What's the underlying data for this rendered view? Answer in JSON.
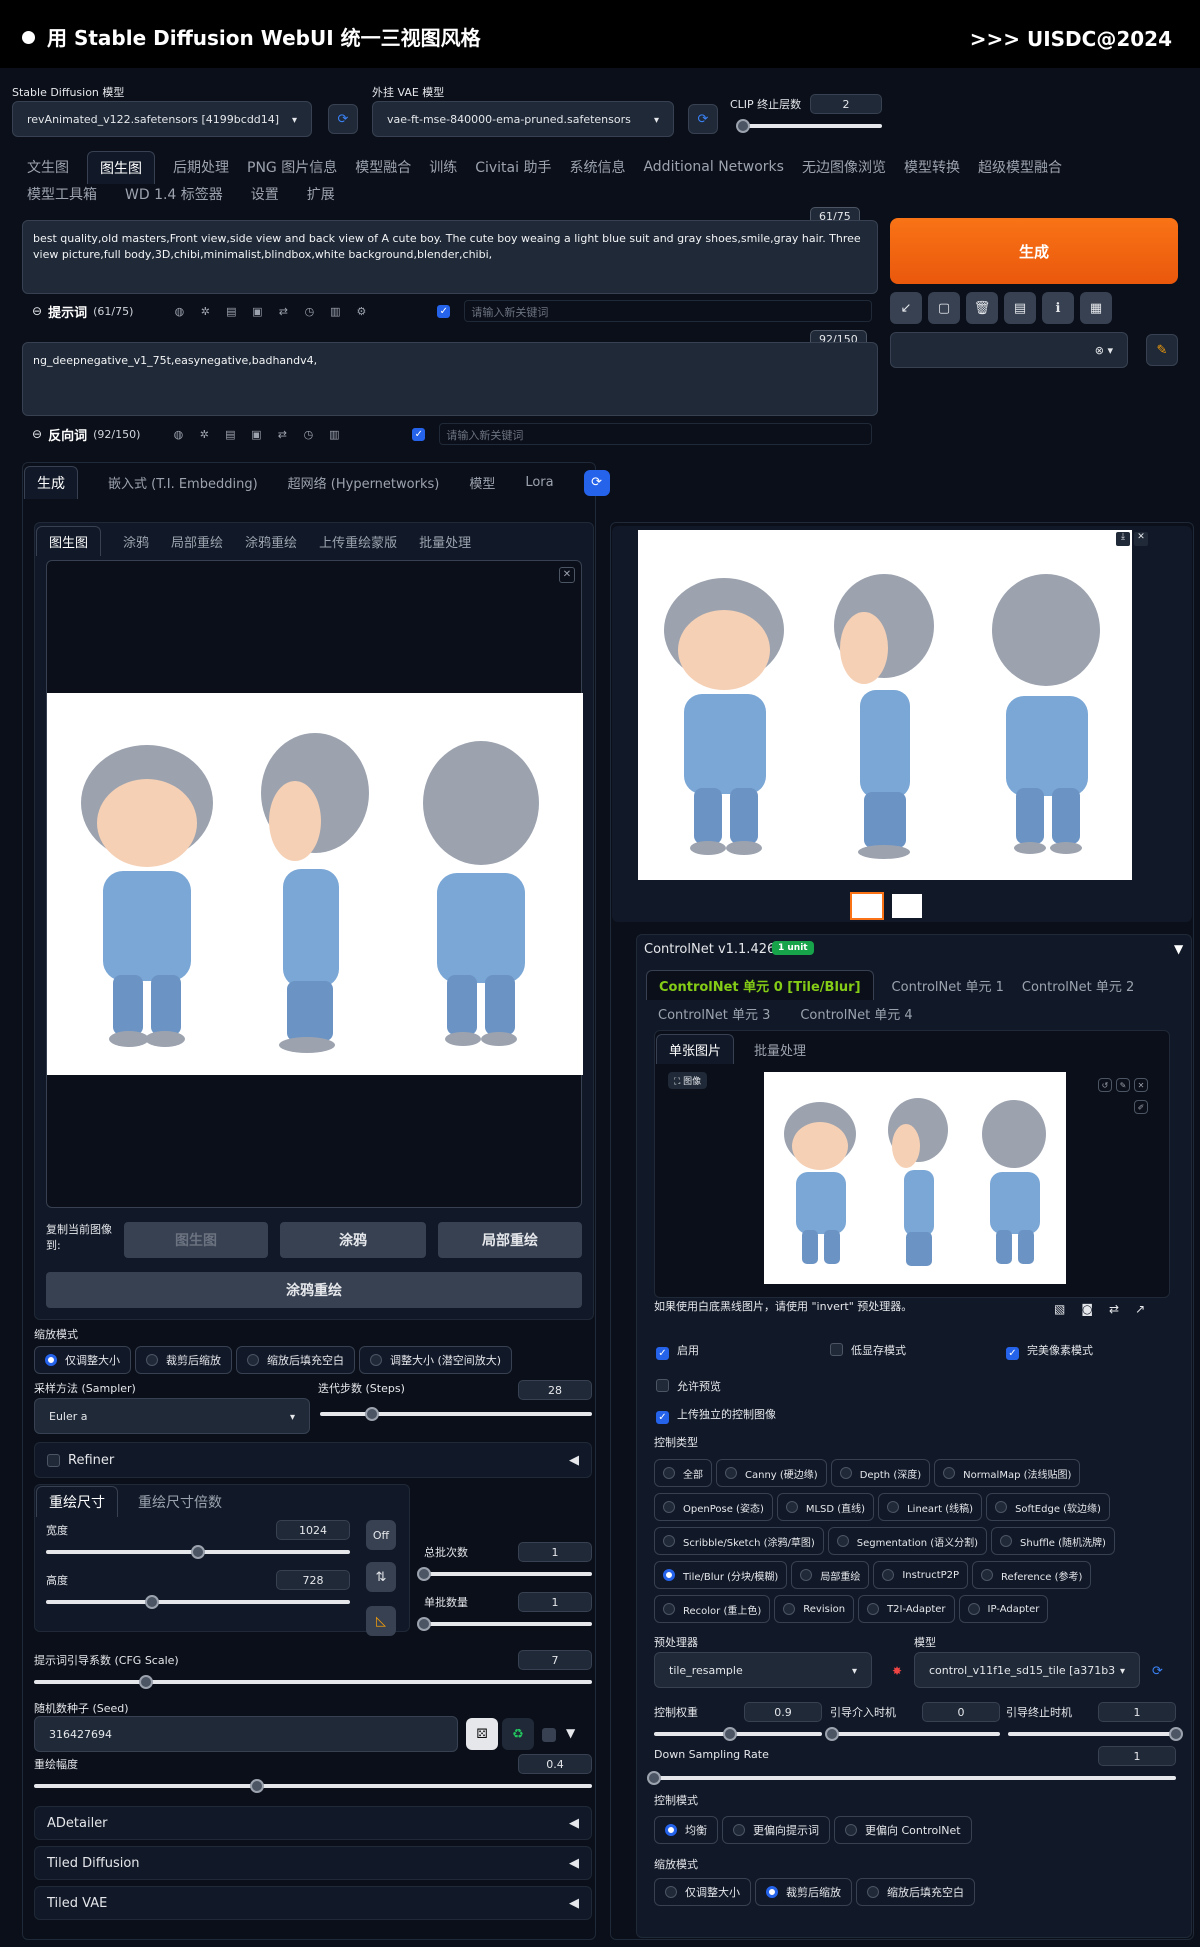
{
  "banner": {
    "title": "用 Stable Diffusion WebUI 统一三视图风格",
    "credit": ">>> UISDC@2024"
  },
  "model": {
    "label": "Stable Diffusion 模型",
    "value": "revAnimated_v122.safetensors [4199bcdd14]"
  },
  "vae": {
    "label": "外挂 VAE 模型",
    "value": "vae-ft-mse-840000-ema-pruned.safetensors"
  },
  "clip": {
    "label": "CLIP 终止层数",
    "value": "2",
    "level": 0.05
  },
  "main_tabs": [
    "文生图",
    "图生图",
    "后期处理",
    "PNG 图片信息",
    "模型融合",
    "训练",
    "Civitai 助手",
    "系统信息",
    "Additional Networks",
    "无边图像浏览",
    "模型转换",
    "超级模型融合",
    "模型工具箱",
    "WD 1.4 标签器",
    "设置",
    "扩展"
  ],
  "prompt": {
    "text": "best quality,old masters,Front view,side view and back view of A cute boy. The cute boy weaing a light blue suit and gray shoes,smile,gray hair. Three view picture,full body,3D,chibi,minimalist,blindbox,white background,blender,chibi,",
    "count": "61/75",
    "label": "提示词",
    "label_count": "(61/75)",
    "kw_placeholder": "请输入新关键词"
  },
  "neg": {
    "text": "ng_deepnegative_v1_75t,easynegative,badhandv4,",
    "count": "92/150",
    "label": "反向词",
    "label_count": "(92/150)",
    "kw_placeholder": "请输入新关键词"
  },
  "generate": "生成",
  "sub_tabs": [
    "生成",
    "嵌入式 (T.I. Embedding)",
    "超网络 (Hypernetworks)",
    "模型",
    "Lora"
  ],
  "img_tabs": [
    "图生图",
    "涂鸦",
    "局部重绘",
    "涂鸦重绘",
    "上传重绘蒙版",
    "批量处理"
  ],
  "copy": {
    "label": "复制当前图像到:",
    "btn1": "图生图",
    "btn2": "涂鸦",
    "btn3": "局部重绘",
    "btn4": "涂鸦重绘"
  },
  "resize": {
    "label": "缩放模式",
    "opts": [
      "仅调整大小",
      "裁剪后缩放",
      "缩放后填充空白",
      "调整大小 (潜空间放大)"
    ]
  },
  "sampler": {
    "label": "采样方法 (Sampler)",
    "value": "Euler a"
  },
  "steps": {
    "label": "迭代步数 (Steps)",
    "value": "28",
    "level": 0.19
  },
  "refiner": "Refiner",
  "size_tabs": [
    "重绘尺寸",
    "重绘尺寸倍数"
  ],
  "width": {
    "label": "宽度",
    "value": "1024",
    "level": 0.5
  },
  "height": {
    "label": "高度",
    "value": "728",
    "level": 0.35
  },
  "off_btn": "Off",
  "batch_count": {
    "label": "总批次数",
    "value": "1",
    "level": 0
  },
  "batch_size": {
    "label": "单批数量",
    "value": "1",
    "level": 0
  },
  "cfg": {
    "label": "提示词引导系数 (CFG Scale)",
    "value": "7",
    "level": 0.2
  },
  "seed": {
    "label": "随机数种子 (Seed)",
    "value": "316427694"
  },
  "denoise": {
    "label": "重绘幅度",
    "value": "0.4",
    "level": 0.4
  },
  "accordions": [
    "ADetailer",
    "Tiled Diffusion",
    "Tiled VAE"
  ],
  "cn": {
    "title": "ControlNet v1.1.426",
    "badge": "1 unit",
    "units": [
      "ControlNet 单元 0 [Tile/Blur]",
      "ControlNet 单元 1",
      "ControlNet 单元 2",
      "ControlNet 单元 3",
      "ControlNet 单元 4"
    ],
    "img_tabs": [
      "单张图片",
      "批量处理"
    ],
    "image_label": "图像",
    "hint": "如果使用白底黑线图片，请使用 \"invert\" 预处理器。",
    "enable": "启用",
    "lowvram": "低显存模式",
    "pixel_perfect": "完美像素模式",
    "preview": "允许预览",
    "upload_independent": "上传独立的控制图像",
    "type_label": "控制类型",
    "types": [
      [
        "全部",
        "Canny (硬边缘)",
        "Depth (深度)",
        "NormalMap (法线贴图)"
      ],
      [
        "OpenPose (姿态)",
        "MLSD (直线)",
        "Lineart (线稿)",
        "SoftEdge (软边缘)"
      ],
      [
        "Scribble/Sketch (涂鸦/草图)",
        "Segmentation (语义分割)",
        "Shuffle (随机洗牌)"
      ],
      [
        "Tile/Blur (分块/模糊)",
        "局部重绘",
        "InstructP2P",
        "Reference (参考)"
      ],
      [
        "Recolor (重上色)",
        "Revision",
        "T2I-Adapter",
        "IP-Adapter"
      ]
    ],
    "preproc": {
      "label": "预处理器",
      "value": "tile_resample"
    },
    "model": {
      "label": "模型",
      "value": "control_v11f1e_sd15_tile [a371b3"
    },
    "weight": {
      "label": "控制权重",
      "value": "0.9",
      "level": 0.45
    },
    "start": {
      "label": "引导介入时机",
      "value": "0",
      "level": 0
    },
    "end": {
      "label": "引导终止时机",
      "value": "1",
      "level": 1
    },
    "downsample": {
      "label": "Down Sampling Rate",
      "value": "1",
      "level": 0
    },
    "mode": {
      "label": "控制模式",
      "opts": [
        "均衡",
        "更偏向提示词",
        "更偏向 ControlNet"
      ]
    },
    "resize": {
      "label": "缩放模式",
      "opts": [
        "仅调整大小",
        "裁剪后缩放",
        "缩放后填充空白"
      ]
    }
  },
  "colors": {
    "accent": "#2563eb",
    "generate": "#f97316",
    "badge": "#16a34a",
    "unit_active": "#84cc16"
  }
}
